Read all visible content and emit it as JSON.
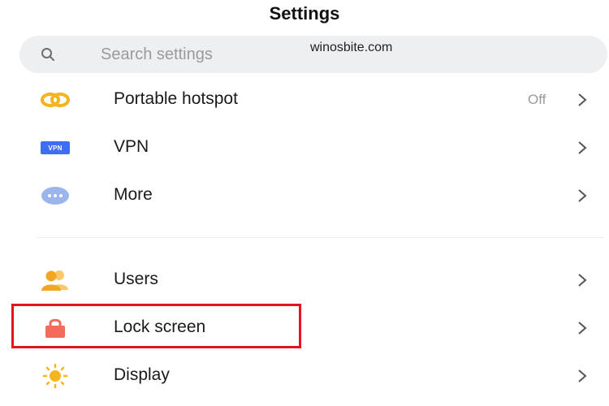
{
  "header": {
    "title": "Settings"
  },
  "search": {
    "placeholder": "Search settings"
  },
  "watermark": "winosbite.com",
  "colors": {
    "hotspot": "#f3b41c",
    "vpn": "#3d6ef5",
    "more": "#9cb5ec",
    "users": "#f4a521",
    "lock": "#f26b5b",
    "display": "#f6b41e",
    "highlight_border": "#e3141e"
  },
  "items": [
    {
      "label": "Portable hotspot",
      "value": "Off",
      "icon": "hotspot-icon"
    },
    {
      "label": "VPN",
      "value": "",
      "icon": "vpn-icon",
      "badge": "VPN"
    },
    {
      "label": "More",
      "value": "",
      "icon": "more-icon"
    },
    {
      "label": "Users",
      "value": "",
      "icon": "users-icon"
    },
    {
      "label": "Lock screen",
      "value": "",
      "icon": "lock-icon",
      "highlighted": true
    },
    {
      "label": "Display",
      "value": "",
      "icon": "display-icon"
    }
  ]
}
